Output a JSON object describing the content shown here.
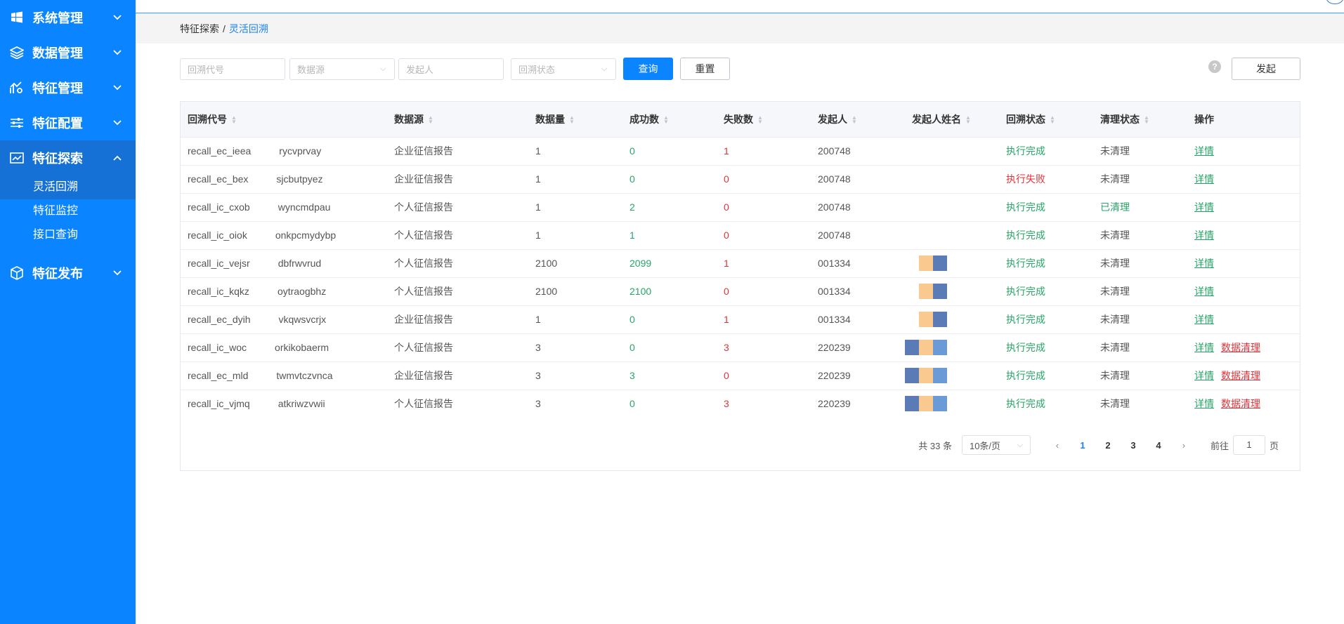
{
  "sidebar": {
    "items": [
      {
        "label": "系统管理",
        "icon": "windows-icon",
        "expanded": false
      },
      {
        "label": "数据管理",
        "icon": "layers-icon",
        "expanded": false
      },
      {
        "label": "特征管理",
        "icon": "chart-gear-icon",
        "expanded": false
      },
      {
        "label": "特征配置",
        "icon": "sliders-icon",
        "expanded": false
      },
      {
        "label": "特征探索",
        "icon": "line-chart-icon",
        "expanded": true,
        "children": [
          {
            "label": "灵活回溯",
            "active": true
          },
          {
            "label": "特征监控",
            "active": false
          },
          {
            "label": "接口查询",
            "active": false
          }
        ]
      },
      {
        "label": "特征发布",
        "icon": "cube-icon",
        "expanded": false
      }
    ]
  },
  "breadcrumb": {
    "parent": "特征探索",
    "separator": "/",
    "current": "灵活回溯"
  },
  "filters": {
    "recall_code_placeholder": "回溯代号",
    "datasource_placeholder": "数据源",
    "initiator_placeholder": "发起人",
    "status_placeholder": "回溯状态",
    "query_label": "查询",
    "reset_label": "重置",
    "launch_label": "发起",
    "help_icon": "?"
  },
  "table": {
    "columns": [
      "回溯代号",
      "数据源",
      "数据量",
      "成功数",
      "失败数",
      "发起人",
      "发起人姓名",
      "回溯状态",
      "清理状态",
      "操作"
    ],
    "rows": [
      {
        "code_a": "recall_ec_ieea",
        "code_b": "rycvprvay",
        "source": "企业征信报告",
        "count": "1",
        "success": "0",
        "fail": "1",
        "initiator": "200748",
        "status": "执行完成",
        "status_color": "#27a567",
        "clean": "未清理",
        "clean_color": "#555555",
        "actions": [
          "详情"
        ]
      },
      {
        "code_a": "recall_ec_bex",
        "code_b": "sjcbutpyez",
        "source": "企业征信报告",
        "count": "1",
        "success": "0",
        "fail": "0",
        "initiator": "200748",
        "status": "执行失败",
        "status_color": "#e0323a",
        "clean": "未清理",
        "clean_color": "#555555",
        "actions": [
          "详情"
        ]
      },
      {
        "code_a": "recall_ic_cxob",
        "code_b": "wyncmdpau",
        "source": "个人征信报告",
        "count": "1",
        "success": "2",
        "fail": "0",
        "initiator": "200748",
        "status": "执行完成",
        "status_color": "#27a567",
        "clean": "已清理",
        "clean_color": "#27a567",
        "actions": [
          "详情"
        ]
      },
      {
        "code_a": "recall_ic_oiok",
        "code_b": "onkpcmydybp",
        "source": "个人征信报告",
        "count": "1",
        "success": "1",
        "fail": "0",
        "initiator": "200748",
        "status": "执行完成",
        "status_color": "#27a567",
        "clean": "未清理",
        "clean_color": "#555555",
        "actions": [
          "详情"
        ]
      },
      {
        "code_a": "recall_ic_vejsr",
        "code_b": "dbfrwvrud",
        "source": "个人征信报告",
        "count": "2100",
        "success": "2099",
        "fail": "1",
        "initiator": "001334",
        "status": "执行完成",
        "status_color": "#27a567",
        "clean": "未清理",
        "clean_color": "#555555",
        "actions": [
          "详情"
        ]
      },
      {
        "code_a": "recall_ic_kqkz",
        "code_b": "oytraogbhz",
        "source": "个人征信报告",
        "count": "2100",
        "success": "2100",
        "fail": "0",
        "initiator": "001334",
        "status": "执行完成",
        "status_color": "#27a567",
        "clean": "未清理",
        "clean_color": "#555555",
        "actions": [
          "详情"
        ]
      },
      {
        "code_a": "recall_ec_dyih",
        "code_b": "vkqwsvcrjx",
        "source": "企业征信报告",
        "count": "1",
        "success": "0",
        "fail": "1",
        "initiator": "001334",
        "status": "执行完成",
        "status_color": "#27a567",
        "clean": "未清理",
        "clean_color": "#555555",
        "actions": [
          "详情"
        ]
      },
      {
        "code_a": "recall_ic_woc",
        "code_b": "orkikobaerm",
        "source": "个人征信报告",
        "count": "3",
        "success": "0",
        "fail": "3",
        "initiator": "220239",
        "status": "执行完成",
        "status_color": "#27a567",
        "clean": "未清理",
        "clean_color": "#555555",
        "actions": [
          "详情",
          "数据清理"
        ]
      },
      {
        "code_a": "recall_ec_mld",
        "code_b": "twmvtczvnca",
        "source": "企业征信报告",
        "count": "3",
        "success": "3",
        "fail": "0",
        "initiator": "220239",
        "status": "执行完成",
        "status_color": "#27a567",
        "clean": "未清理",
        "clean_color": "#555555",
        "actions": [
          "详情",
          "数据清理"
        ]
      },
      {
        "code_a": "recall_ic_vjmq",
        "code_b": "atkriwzvwii",
        "source": "个人征信报告",
        "count": "3",
        "success": "0",
        "fail": "3",
        "initiator": "220239",
        "status": "执行完成",
        "status_color": "#27a567",
        "clean": "未清理",
        "clean_color": "#555555",
        "actions": [
          "详情",
          "数据清理"
        ]
      }
    ]
  },
  "pagination": {
    "total": "共 33 条",
    "page_size": "10条/页",
    "pages": [
      "1",
      "2",
      "3",
      "4"
    ],
    "current": "1",
    "goto_prefix": "前往",
    "goto_value": "1",
    "goto_suffix": "页"
  }
}
